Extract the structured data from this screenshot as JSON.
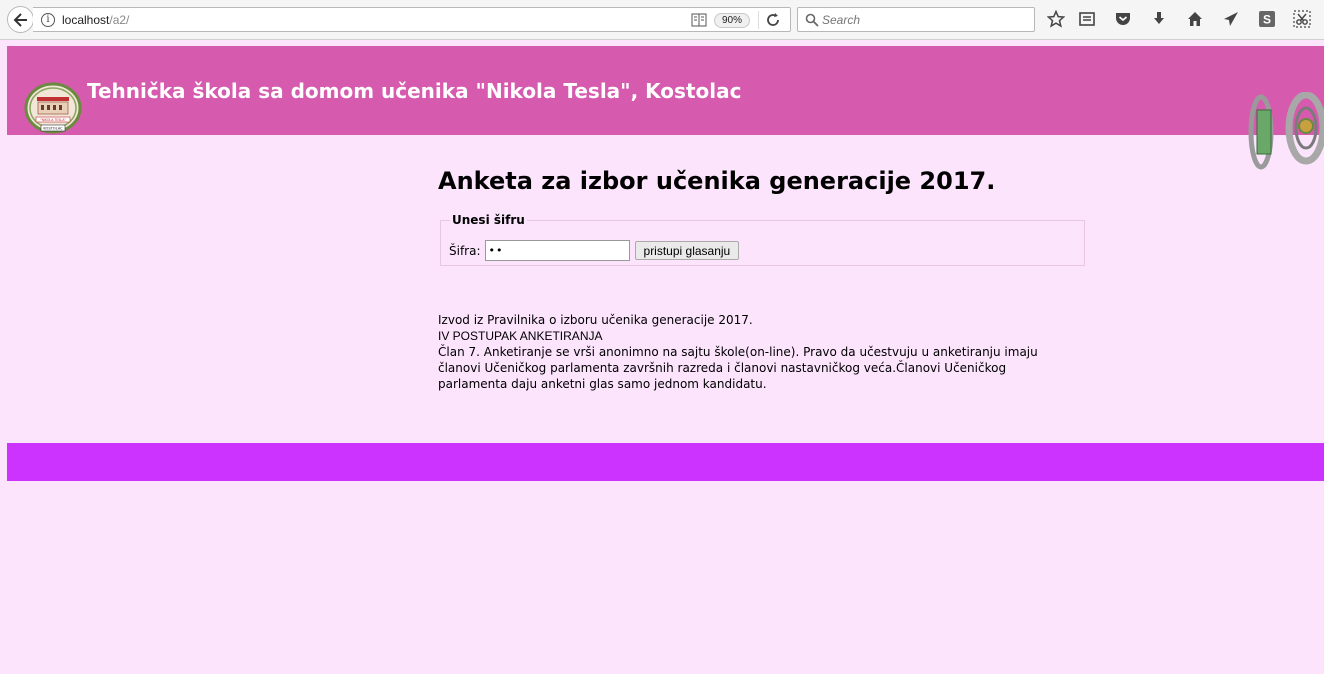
{
  "browser": {
    "url_host": "localhost",
    "url_path": "/a2/",
    "zoom": "90%",
    "search_placeholder": "Search"
  },
  "header": {
    "title": "Tehnička škola sa domom učenika \"Nikola Tesla\", Kostolac",
    "background_color": "#d65aae",
    "logo_icon": "school-seal-logo",
    "logo_text": [
      "\"NIKOLA TESLA\"",
      "KOSTOLAC"
    ]
  },
  "main": {
    "title": "Anketa za izbor učenika generacije 2017.",
    "login": {
      "legend": "Unesi šifru",
      "label": "Šifra:",
      "password_value": "••",
      "button_label": "pristupi glasanju"
    },
    "rules": {
      "line1": "Izvod iz Pravilnika o izboru učenika generacije 2017.",
      "line2": "IV POSTUPAK ANKETIRANJA",
      "line3": "Član 7. Anketiranje se vrši anonimno na sajtu škole(on-line). Pravo da učestvuju u anketiranju imaju",
      "line4": "članovi Učeničkog parlamenta završnih razreda i članovi nastavničkog veća.Članovi Učeničkog",
      "line5": "parlamenta daju anketni glas samo jednom kandidatu."
    }
  },
  "footer": {
    "background_color": "#cc33ff"
  },
  "page_background": "#fce4fc"
}
